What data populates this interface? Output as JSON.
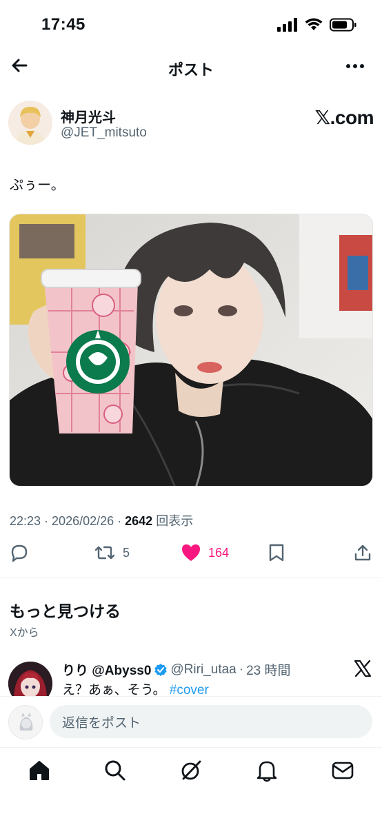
{
  "status_bar": {
    "time": "17:45",
    "icons": [
      "signal-icon",
      "wifi-icon",
      "battery-icon"
    ]
  },
  "header": {
    "title": "ポスト",
    "back_icon": "arrow-left-icon",
    "more_icon": "more-icon"
  },
  "author": {
    "name": "神月光斗",
    "handle": "@JET_mitsuto",
    "brand": "𝕏.com"
  },
  "tweet": {
    "text": "ぷぅー。"
  },
  "meta": {
    "time": "22:23",
    "sep1": " · ",
    "date": "2026/02/26",
    "sep2": " · ",
    "views": "2642",
    "views_label": " 回表示"
  },
  "actions": {
    "reply_icon": "reply-icon",
    "retweets": "5",
    "likes": "164",
    "bookmark_icon": "bookmark-icon",
    "share_icon": "share-icon",
    "like_color": "#f91880"
  },
  "discover": {
    "title": "もっと見つける",
    "subtitle": "Xから"
  },
  "related": {
    "name": "りり @Abyss0",
    "handle": "@Riri_utaa",
    "sep": " · ",
    "time": "23 時間",
    "text": "え？あぁ、そう。",
    "hashtag": "#cover"
  },
  "reply": {
    "placeholder": "返信をポスト"
  },
  "tabs": [
    "home-icon",
    "search-icon",
    "grok-icon",
    "notifications-icon",
    "messages-icon"
  ],
  "colors": {
    "accent": "#1d9bf0",
    "like": "#f91880",
    "text": "#0f1419",
    "muted": "#536471"
  }
}
